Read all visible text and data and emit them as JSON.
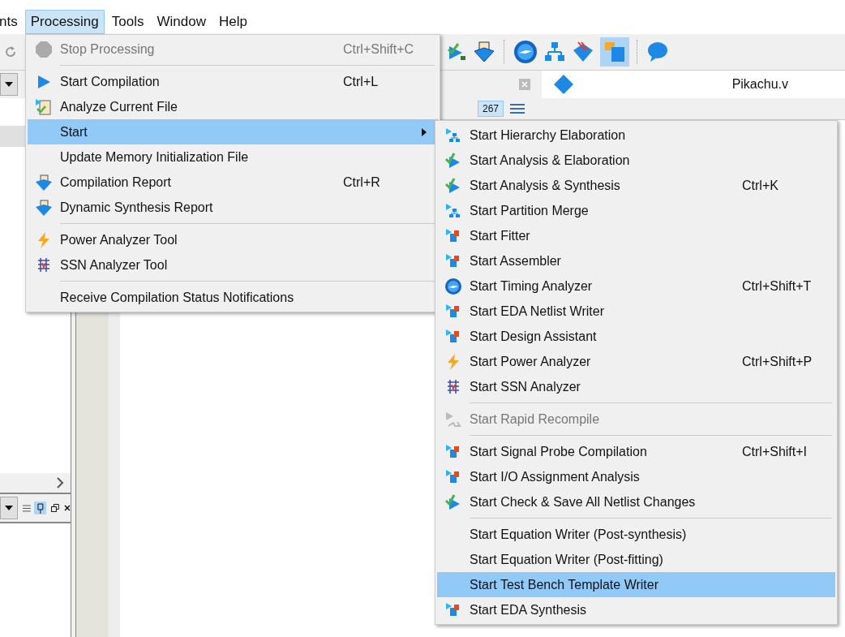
{
  "menubar": [
    {
      "label": "nts",
      "selected": false
    },
    {
      "label": "Processing",
      "selected": true
    },
    {
      "label": "Tools",
      "selected": false
    },
    {
      "label": "Window",
      "selected": false
    },
    {
      "label": "Help",
      "selected": false
    }
  ],
  "editor_tab": {
    "label": "Pikachu.v"
  },
  "line_count": "267",
  "processing_menu": [
    {
      "kind": "item",
      "label": "Stop Processing",
      "shortcut": "Ctrl+Shift+C",
      "disabled": true,
      "selected": false,
      "submenu": false
    },
    {
      "kind": "separator"
    },
    {
      "kind": "item",
      "label": "Start Compilation",
      "shortcut": "Ctrl+L",
      "disabled": false,
      "selected": false,
      "submenu": false
    },
    {
      "kind": "item",
      "label": "Analyze Current File",
      "disabled": false,
      "selected": false,
      "submenu": false
    },
    {
      "kind": "item",
      "label": "Start",
      "disabled": false,
      "selected": true,
      "submenu": true
    },
    {
      "kind": "item",
      "label": "Update Memory Initialization File",
      "disabled": false,
      "selected": false,
      "submenu": false
    },
    {
      "kind": "item",
      "label": "Compilation Report",
      "shortcut": "Ctrl+R",
      "disabled": false,
      "selected": false,
      "submenu": false
    },
    {
      "kind": "item",
      "label": "Dynamic Synthesis Report",
      "disabled": false,
      "selected": false,
      "submenu": false
    },
    {
      "kind": "separator"
    },
    {
      "kind": "item",
      "label": "Power Analyzer Tool",
      "disabled": false,
      "selected": false,
      "submenu": false
    },
    {
      "kind": "item",
      "label": "SSN Analyzer Tool",
      "disabled": false,
      "selected": false,
      "submenu": false
    },
    {
      "kind": "separator"
    },
    {
      "kind": "item",
      "label": "Receive Compilation Status Notifications",
      "disabled": false,
      "selected": false,
      "submenu": false
    }
  ],
  "start_submenu": [
    {
      "kind": "item",
      "label": "Start Hierarchy Elaboration",
      "disabled": false,
      "selected": false
    },
    {
      "kind": "item",
      "label": "Start Analysis & Elaboration",
      "disabled": false,
      "selected": false
    },
    {
      "kind": "item",
      "label": "Start Analysis & Synthesis",
      "shortcut": "Ctrl+K",
      "disabled": false,
      "selected": false
    },
    {
      "kind": "item",
      "label": "Start Partition Merge",
      "disabled": false,
      "selected": false
    },
    {
      "kind": "item",
      "label": "Start Fitter",
      "disabled": false,
      "selected": false
    },
    {
      "kind": "item",
      "label": "Start Assembler",
      "disabled": false,
      "selected": false
    },
    {
      "kind": "item",
      "label": "Start Timing Analyzer",
      "shortcut": "Ctrl+Shift+T",
      "disabled": false,
      "selected": false
    },
    {
      "kind": "item",
      "label": "Start EDA Netlist Writer",
      "disabled": false,
      "selected": false
    },
    {
      "kind": "item",
      "label": "Start Design Assistant",
      "disabled": false,
      "selected": false
    },
    {
      "kind": "item",
      "label": "Start Power Analyzer",
      "shortcut": "Ctrl+Shift+P",
      "disabled": false,
      "selected": false
    },
    {
      "kind": "item",
      "label": "Start SSN Analyzer",
      "disabled": false,
      "selected": false
    },
    {
      "kind": "separator"
    },
    {
      "kind": "item",
      "label": "Start Rapid Recompile",
      "disabled": true,
      "selected": false
    },
    {
      "kind": "separator"
    },
    {
      "kind": "item",
      "label": "Start Signal Probe Compilation",
      "shortcut": "Ctrl+Shift+I",
      "disabled": false,
      "selected": false
    },
    {
      "kind": "item",
      "label": "Start I/O Assignment Analysis",
      "disabled": false,
      "selected": false
    },
    {
      "kind": "item",
      "label": "Start Check & Save All Netlist Changes",
      "disabled": false,
      "selected": false
    },
    {
      "kind": "separator"
    },
    {
      "kind": "item",
      "label": "Start Equation Writer (Post-synthesis)",
      "disabled": false,
      "selected": false
    },
    {
      "kind": "item",
      "label": "Start Equation Writer (Post-fitting)",
      "disabled": false,
      "selected": false
    },
    {
      "kind": "item",
      "label": "Start Test Bench Template Writer",
      "disabled": false,
      "selected": true
    },
    {
      "kind": "item",
      "label": "Start EDA Synthesis",
      "disabled": false,
      "selected": false
    }
  ]
}
